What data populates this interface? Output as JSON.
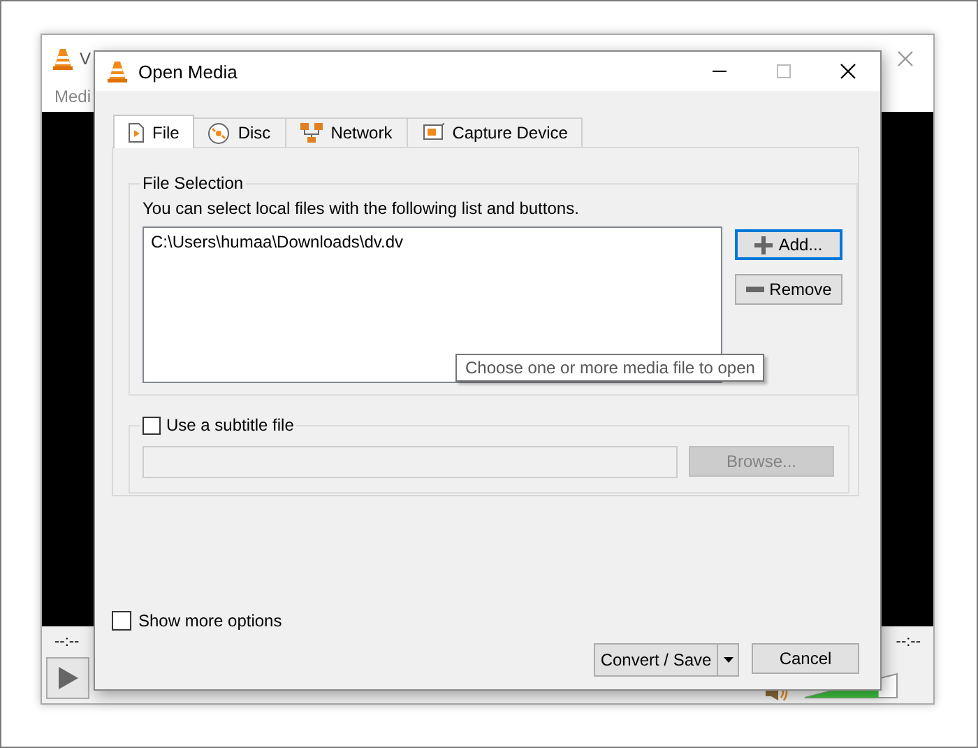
{
  "background_window": {
    "title": "V",
    "menu": [
      "Medi"
    ],
    "time_elapsed": "--:--",
    "time_total": "--:--",
    "volume": {
      "level": 0.8
    }
  },
  "dialog": {
    "title": "Open Media",
    "tabs": [
      {
        "label": "File",
        "selected": true,
        "kind": "file"
      },
      {
        "label": "Disc",
        "selected": false,
        "kind": "disc"
      },
      {
        "label": "Network",
        "selected": false,
        "kind": "network"
      },
      {
        "label": "Capture Device",
        "selected": false,
        "kind": "capture"
      }
    ],
    "file_selection": {
      "title": "File Selection",
      "hint": "You can select local files with the following list and buttons.",
      "files": [
        "C:\\Users\\humaa\\Downloads\\dv.dv"
      ],
      "buttons": [
        {
          "label": "Add...",
          "kind": "add",
          "focused": true
        },
        {
          "label": "Remove",
          "kind": "remove",
          "focused": false
        }
      ]
    },
    "tooltip": "Choose one or more media file to open",
    "subtitle": {
      "label": "Use a subtitle file",
      "checked": false,
      "browse": {
        "label": "Browse...",
        "disabled": true
      }
    },
    "show_more_options": {
      "label": "Show more options",
      "checked": false
    },
    "buttons": [
      {
        "label": "Convert / Save",
        "kind": "split"
      },
      {
        "label": "Cancel",
        "kind": "plain"
      }
    ]
  }
}
